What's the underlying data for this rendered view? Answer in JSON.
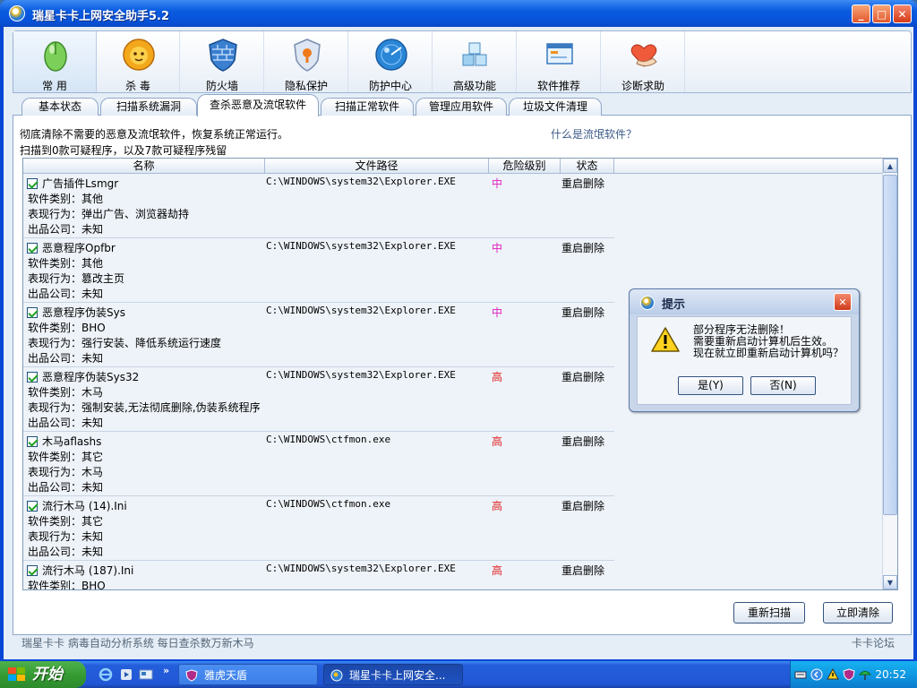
{
  "window": {
    "title": "瑞星卡卡上网安全助手5.2",
    "controls": {
      "minimize": "_",
      "maximize": "□",
      "close": "✕"
    }
  },
  "toolbar": {
    "items": [
      {
        "label": "常 用",
        "icon": "mouse-icon"
      },
      {
        "label": "杀 毒",
        "icon": "lion-shield-icon"
      },
      {
        "label": "防火墙",
        "icon": "firewall-shield-icon"
      },
      {
        "label": "隐私保护",
        "icon": "privacy-shield-icon"
      },
      {
        "label": "防护中心",
        "icon": "radar-icon"
      },
      {
        "label": "高级功能",
        "icon": "cubes-icon"
      },
      {
        "label": "软件推荐",
        "icon": "windows-icon"
      },
      {
        "label": "诊断求助",
        "icon": "heart-hands-icon"
      }
    ]
  },
  "tabs": [
    "基本状态",
    "扫描系统漏洞",
    "查杀恶意及流氓软件",
    "扫描正常软件",
    "管理应用软件",
    "垃圾文件清理"
  ],
  "active_tab": "查杀恶意及流氓软件",
  "description": {
    "line1": "彻底清除不需要的恶意及流氓软件，恢复系统正常运行。",
    "link": "什么是流氓软件？",
    "line2": "扫描到0款可疑程序，以及7款可疑程序残留"
  },
  "table": {
    "headers": {
      "name": "名称",
      "path": "文件路径",
      "risk": "危险级别",
      "status": "状态"
    },
    "rows": [
      {
        "name": "广告插件Lsmgr",
        "path": "C:\\WINDOWS\\system32\\Explorer.EXE",
        "risk": "中",
        "status": "重启删除",
        "details": [
          "软件类别：其他",
          "表现行为：弹出广告、浏览器劫持",
          "出品公司：未知"
        ]
      },
      {
        "name": "恶意程序Opfbr",
        "path": "C:\\WINDOWS\\system32\\Explorer.EXE",
        "risk": "中",
        "status": "重启删除",
        "details": [
          "软件类别：其他",
          "表现行为：篡改主页",
          "出品公司：未知"
        ]
      },
      {
        "name": "恶意程序伪装Sys",
        "path": "C:\\WINDOWS\\system32\\Explorer.EXE",
        "risk": "中",
        "status": "重启删除",
        "details": [
          "软件类别：BHO",
          "表现行为：强行安装、降低系统运行速度",
          "出品公司：未知"
        ]
      },
      {
        "name": "恶意程序伪装Sys32",
        "path": "C:\\WINDOWS\\system32\\Explorer.EXE",
        "risk": "高",
        "status": "重启删除",
        "details": [
          "软件类别：木马",
          "表现行为：强制安装,无法彻底删除,伪装系统程序",
          "出品公司：未知"
        ]
      },
      {
        "name": "木马aflashs",
        "path": "C:\\WINDOWS\\ctfmon.exe",
        "risk": "高",
        "status": "重启删除",
        "details": [
          "软件类别：其它",
          "表现行为：木马",
          "出品公司：未知"
        ]
      },
      {
        "name": "流行木马 (14).Ini",
        "path": "C:\\WINDOWS\\ctfmon.exe",
        "risk": "高",
        "status": "重启删除",
        "details": [
          "软件类别：其它",
          "表现行为：未知",
          "出品公司：未知"
        ]
      },
      {
        "name": "流行木马 (187).Ini",
        "path": "C:\\WINDOWS\\system32\\Explorer.EXE",
        "risk": "高",
        "status": "重启删除",
        "details": [
          "软件类别：BHO"
        ]
      }
    ]
  },
  "risk_colors": {
    "中": "#e020c0",
    "高": "#e02020"
  },
  "buttons": {
    "rescan": "重新扫描",
    "clean_now": "立即清除"
  },
  "footer": {
    "left": "瑞星卡卡  病毒自动分析系统  每日查杀数万新木马",
    "right": "卡卡论坛"
  },
  "dialog": {
    "title": "提示",
    "lines": [
      "部分程序无法删除！",
      "需要重新启动计算机后生效。",
      "现在就立即重新启动计算机吗？"
    ],
    "yes": "是(Y)",
    "no": "否(N)"
  },
  "taskbar": {
    "start": "开始",
    "tasks": [
      {
        "label": "雅虎天盾",
        "active": false
      },
      {
        "label": "瑞星卡卡上网安全...",
        "active": true
      }
    ],
    "clock": "20:52"
  }
}
